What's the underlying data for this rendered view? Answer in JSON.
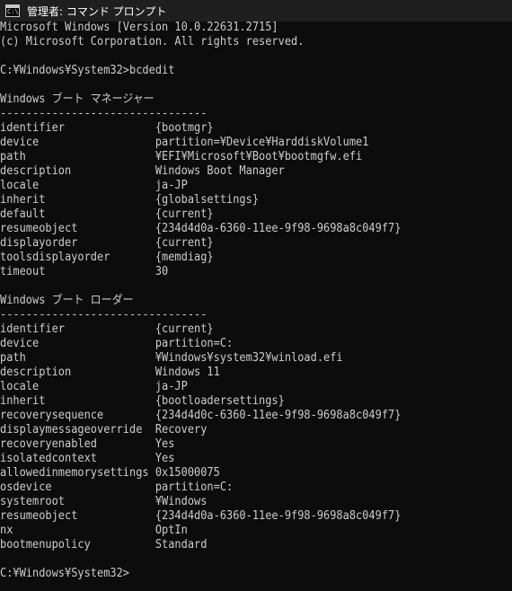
{
  "window": {
    "title": "管理者: コマンド プロンプト",
    "icon": "cmd-icon",
    "icon_glyph": "C:\\"
  },
  "console_lines": [
    "Microsoft Windows [Version 10.0.22631.2715]",
    "(c) Microsoft Corporation. All rights reserved.",
    "",
    "C:¥Windows¥System32>bcdedit",
    "",
    "Windows ブート マネージャー",
    "--------------------------------",
    "identifier              {bootmgr}",
    "device                  partition=¥Device¥HarddiskVolume1",
    "path                    ¥EFI¥Microsoft¥Boot¥bootmgfw.efi",
    "description             Windows Boot Manager",
    "locale                  ja-JP",
    "inherit                 {globalsettings}",
    "default                 {current}",
    "resumeobject            {234d4d0a-6360-11ee-9f98-9698a8c049f7}",
    "displayorder            {current}",
    "toolsdisplayorder       {memdiag}",
    "timeout                 30",
    "",
    "Windows ブート ローダー",
    "--------------------------------",
    "identifier              {current}",
    "device                  partition=C:",
    "path                    ¥Windows¥system32¥winload.efi",
    "description             Windows 11",
    "locale                  ja-JP",
    "inherit                 {bootloadersettings}",
    "recoverysequence        {234d4d0c-6360-11ee-9f98-9698a8c049f7}",
    "displaymessageoverride  Recovery",
    "recoveryenabled         Yes",
    "isolatedcontext         Yes",
    "allowedinmemorysettings 0x15000075",
    "osdevice                partition=C:",
    "systemroot              ¥Windows",
    "resumeobject            {234d4d0a-6360-11ee-9f98-9698a8c049f7}",
    "nx                      OptIn",
    "bootmenupolicy          Standard",
    "",
    "C:¥Windows¥System32>"
  ]
}
